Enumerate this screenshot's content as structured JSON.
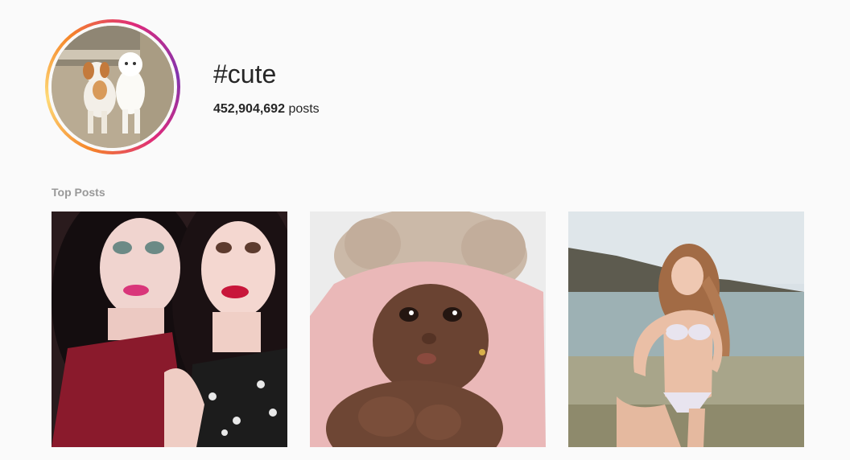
{
  "hashtag": {
    "title": "#cute",
    "post_count": "452,904,692",
    "post_count_suffix": "posts",
    "avatar_icon": "dogs-photo"
  },
  "top_posts": {
    "label": "Top Posts",
    "items": [
      {
        "image": "two-women-selfie-photo"
      },
      {
        "image": "baby-in-towel-photo"
      },
      {
        "image": "woman-at-beach-photo"
      }
    ]
  }
}
